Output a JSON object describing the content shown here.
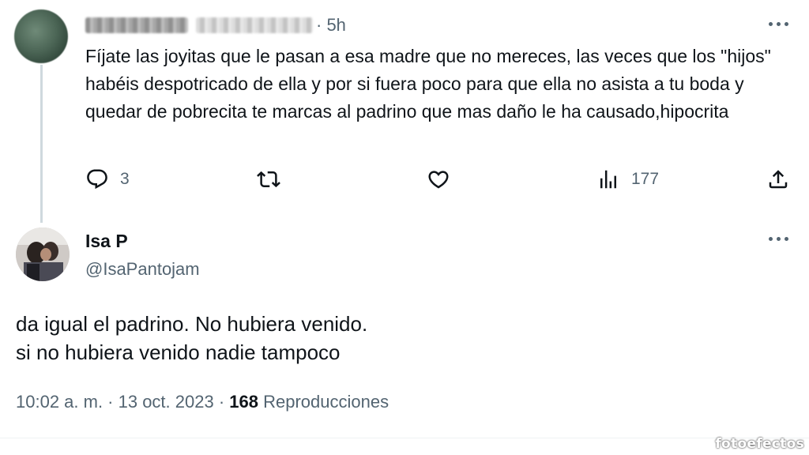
{
  "reply_tweet": {
    "time": "· 5h",
    "text": "Fíjate las joyitas que le pasan a esa madre que no mereces, las veces que los \"hijos\" habéis despotricado de ella y por  si fuera poco para que ella no asista a tu boda y quedar de pobrecita te marcas al padrino que mas daño le ha causado,hipocrita",
    "actions": {
      "reply_icon": "reply-icon",
      "reply_count": "3",
      "retweet_icon": "retweet-icon",
      "like_icon": "heart-icon",
      "views_icon": "bar-chart-icon",
      "views_count": "177",
      "share_icon": "share-icon"
    }
  },
  "main_tweet": {
    "display_name": "Isa P",
    "handle": "@IsaPantojam",
    "lines": [
      "da igual el padrino. No hubiera venido.",
      "si no hubiera venido nadie tampoco"
    ],
    "timestamp": "10:02 a. m. · 13 oct. 2023 ·",
    "views_count": "168",
    "views_label": "Reproducciones"
  },
  "watermark": "fotoefectos",
  "colors": {
    "text_primary": "#0f1419",
    "text_secondary": "#536471",
    "thread_line": "#cfd9de"
  }
}
